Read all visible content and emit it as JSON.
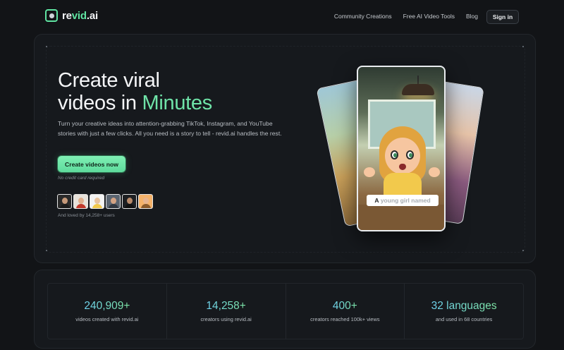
{
  "brand": {
    "name_part1": "re",
    "name_accent": "vid",
    "name_part2": ".ai",
    "accent_color": "#5fe3a1"
  },
  "nav": {
    "links": [
      {
        "label": "Community Creations"
      },
      {
        "label": "Free AI Video Tools"
      },
      {
        "label": "Blog"
      }
    ],
    "sign_in_label": "Sign in"
  },
  "hero": {
    "title_line1": "Create viral",
    "title_line2_prefix": "videos in ",
    "title_line2_highlight": "Minutes",
    "description": "Turn your creative ideas into attention-grabbing TikTok, Instagram, and YouTube stories with just a few clicks. All you need is a story to tell - revid.ai handles the rest.",
    "cta_label": "Create videos now",
    "no_credit_card": "No credit card required",
    "loved_by": "And loved by 14,258+ users",
    "avatar_count": 6
  },
  "preview": {
    "caption_bold": "A",
    "caption_dim": "young girl named"
  },
  "stats": [
    {
      "value": "240,909+",
      "label": "videos created with revid.ai"
    },
    {
      "value": "14,258+",
      "label": "creators using revid.ai"
    },
    {
      "value": "400+",
      "label": "creators reached 100k+ views"
    },
    {
      "value": "32 languages",
      "label": "and used in 68 countries"
    }
  ]
}
